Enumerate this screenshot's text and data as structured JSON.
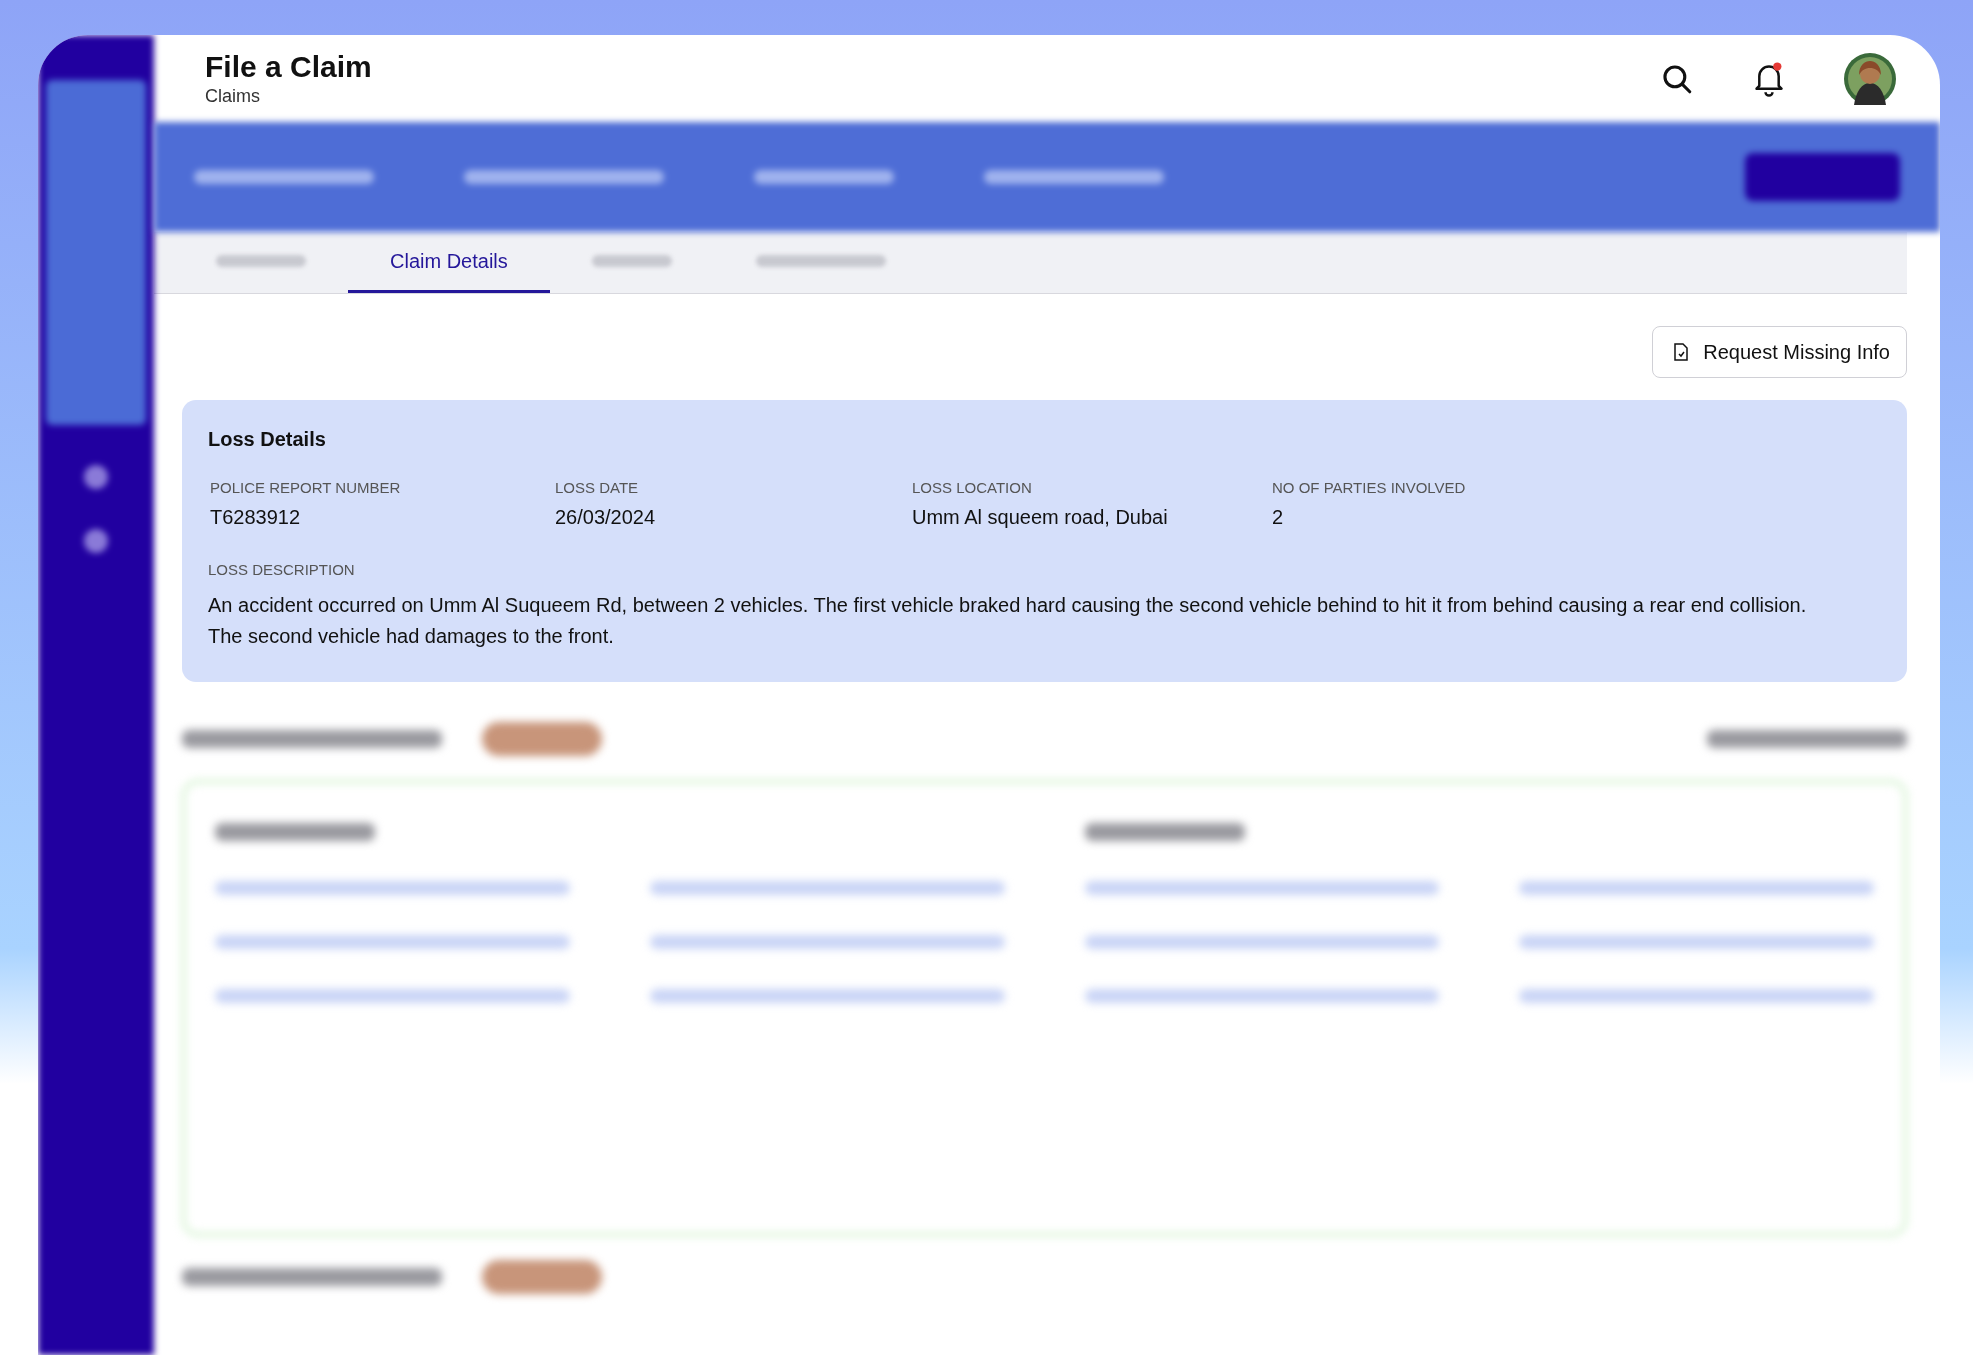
{
  "header": {
    "title": "File a Claim",
    "subtitle": "Claims",
    "notification_unread": true
  },
  "tabs": [
    {
      "kind": "blurred",
      "selected": false
    },
    {
      "kind": "text",
      "label": "Claim Details",
      "selected": true
    },
    {
      "kind": "blurred",
      "selected": false
    },
    {
      "kind": "blurred",
      "selected": false
    }
  ],
  "request_button": "Request Missing Info",
  "loss_details": {
    "title": "Loss Details",
    "fields": [
      {
        "label": "POLICE REPORT NUMBER",
        "value": "T6283912"
      },
      {
        "label": "LOSS DATE",
        "value": "26/03/2024"
      },
      {
        "label": "LOSS LOCATION",
        "value": "Umm Al squeem road, Dubai"
      },
      {
        "label": "NO OF PARTIES INVOLVED",
        "value": "2"
      }
    ],
    "description_label": "LOSS DESCRIPTION",
    "description": "An accident occurred on Umm Al Suqueem Rd, between 2 vehicles. The first vehicle braked hard causing the second vehicle behind to hit it from behind causing a rear end collision. The second vehicle had damages to the front."
  }
}
